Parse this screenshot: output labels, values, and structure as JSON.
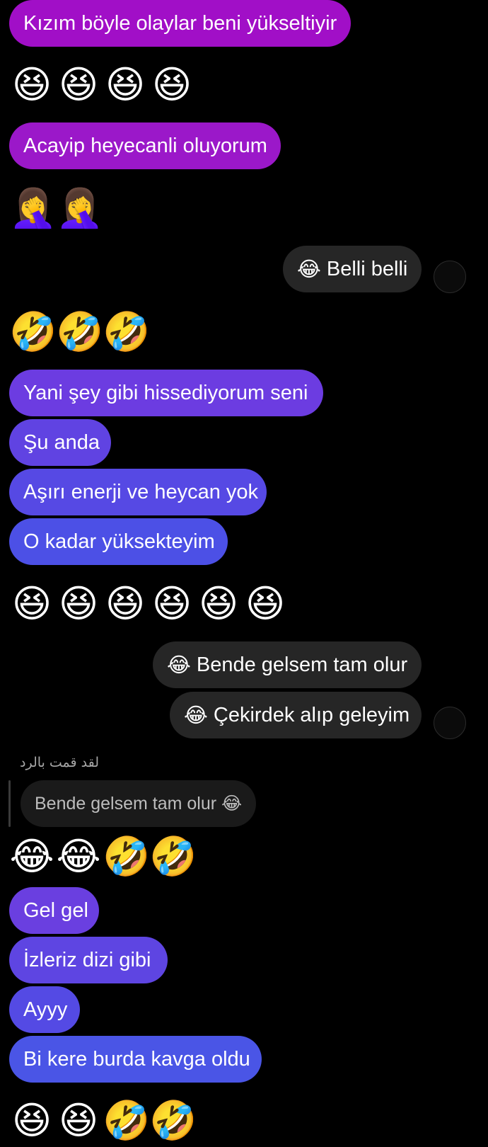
{
  "messages": {
    "m1": "Kızım böyle olaylar beni yükseltiyir",
    "e1": [
      "😆",
      "😆",
      "😆",
      "😆"
    ],
    "m2": "Acayip heyecanli oluyorum",
    "e2": [
      "🤦‍♀️",
      "🤦‍♀️"
    ],
    "o1_emoji": "😂",
    "o1_text": "Belli belli",
    "e3": [
      "🤣",
      "🤣",
      "🤣"
    ],
    "m3": "Yani şey gibi hissediyorum seni",
    "m4": "Şu anda",
    "m5": "Aşırı enerji ve heycan yok",
    "m6": "O kadar yüksekteyim",
    "e4": [
      "😆",
      "😆",
      "😆",
      "😆",
      "😆",
      "😆"
    ],
    "o2_emoji": "😂",
    "o2_text": "Bende gelsem tam olur",
    "o3_emoji": "😂",
    "o3_text": "Çekirdek alıp geleyim",
    "reply_label": "لقد قمت بالرد",
    "reply_quote": "Bende gelsem tam olur 😂",
    "e5": [
      "😂",
      "😂",
      "🤣",
      "🤣"
    ],
    "m7": "Gel gel",
    "m8": "İzleriz dizi gibi",
    "m9": "Ayyy",
    "m10": "Bi kere burda kavga oldu",
    "e6": [
      "😆",
      "😆",
      "🤣",
      "🤣"
    ]
  },
  "colors": {
    "purple_top": "#a10fc7",
    "purple_mid": "#8c2ad0",
    "violet": "#6a3fe0",
    "blue": "#4a55e6",
    "outgoing": "#262626"
  }
}
